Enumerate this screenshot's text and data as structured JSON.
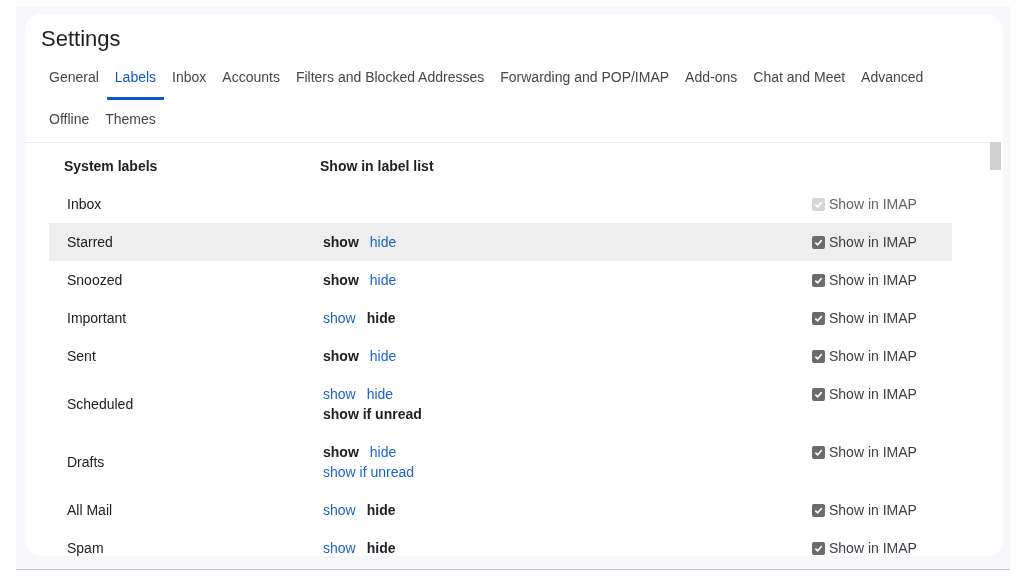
{
  "title": "Settings",
  "tabs": [
    {
      "label": "General",
      "selected": false
    },
    {
      "label": "Labels",
      "selected": true
    },
    {
      "label": "Inbox",
      "selected": false
    },
    {
      "label": "Accounts",
      "selected": false
    },
    {
      "label": "Filters and Blocked Addresses",
      "selected": false
    },
    {
      "label": "Forwarding and POP/IMAP",
      "selected": false
    },
    {
      "label": "Add-ons",
      "selected": false
    },
    {
      "label": "Chat and Meet",
      "selected": false
    },
    {
      "label": "Advanced",
      "selected": false
    },
    {
      "label": "Offline",
      "selected": false
    },
    {
      "label": "Themes",
      "selected": false
    }
  ],
  "table": {
    "columns": [
      "System labels",
      "Show in label list"
    ],
    "rows": [
      {
        "name": "Inbox",
        "highlighted": false,
        "option_lines": [],
        "imap": {
          "label": "Show in IMAP",
          "checked": true,
          "disabled": true
        }
      },
      {
        "name": "Starred",
        "highlighted": true,
        "option_lines": [
          [
            {
              "label": "show",
              "selected": true
            },
            {
              "label": "hide",
              "selected": false
            }
          ]
        ],
        "imap": {
          "label": "Show in IMAP",
          "checked": true,
          "disabled": false
        }
      },
      {
        "name": "Snoozed",
        "highlighted": false,
        "option_lines": [
          [
            {
              "label": "show",
              "selected": true
            },
            {
              "label": "hide",
              "selected": false
            }
          ]
        ],
        "imap": {
          "label": "Show in IMAP",
          "checked": true,
          "disabled": false
        }
      },
      {
        "name": "Important",
        "highlighted": false,
        "option_lines": [
          [
            {
              "label": "show",
              "selected": false
            },
            {
              "label": "hide",
              "selected": true
            }
          ]
        ],
        "imap": {
          "label": "Show in IMAP",
          "checked": true,
          "disabled": false
        }
      },
      {
        "name": "Sent",
        "highlighted": false,
        "option_lines": [
          [
            {
              "label": "show",
              "selected": true
            },
            {
              "label": "hide",
              "selected": false
            }
          ]
        ],
        "imap": {
          "label": "Show in IMAP",
          "checked": true,
          "disabled": false
        }
      },
      {
        "name": "Scheduled",
        "highlighted": false,
        "option_lines": [
          [
            {
              "label": "show",
              "selected": false
            },
            {
              "label": "hide",
              "selected": false
            }
          ],
          [
            {
              "label": "show if unread",
              "selected": true
            }
          ]
        ],
        "imap": {
          "label": "Show in IMAP",
          "checked": true,
          "disabled": false
        }
      },
      {
        "name": "Drafts",
        "highlighted": false,
        "option_lines": [
          [
            {
              "label": "show",
              "selected": true
            },
            {
              "label": "hide",
              "selected": false
            }
          ],
          [
            {
              "label": "show if unread",
              "selected": false
            }
          ]
        ],
        "imap": {
          "label": "Show in IMAP",
          "checked": true,
          "disabled": false
        }
      },
      {
        "name": "All Mail",
        "highlighted": false,
        "option_lines": [
          [
            {
              "label": "show",
              "selected": false
            },
            {
              "label": "hide",
              "selected": true
            }
          ]
        ],
        "imap": {
          "label": "Show in IMAP",
          "checked": true,
          "disabled": false
        }
      },
      {
        "name": "Spam",
        "highlighted": false,
        "option_lines": [
          [
            {
              "label": "show",
              "selected": false
            },
            {
              "label": "hide",
              "selected": true
            }
          ]
        ],
        "imap": {
          "label": "Show in IMAP",
          "checked": true,
          "disabled": false
        }
      }
    ]
  }
}
